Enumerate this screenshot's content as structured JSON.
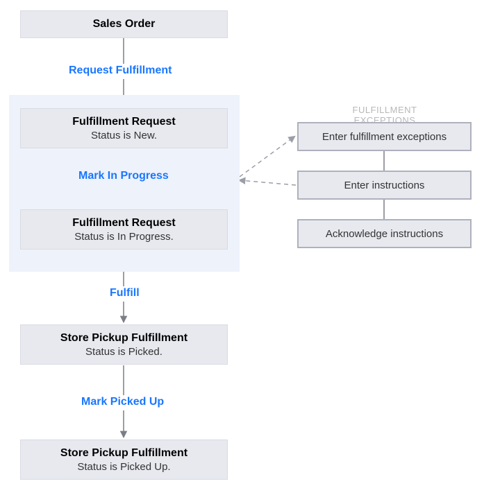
{
  "nodes": {
    "sales_order": {
      "title": "Sales Order"
    },
    "fr_new": {
      "title": "Fulfillment Request",
      "status": "Status is New."
    },
    "fr_inprogress": {
      "title": "Fulfillment Request",
      "status": "Status is In Progress."
    },
    "sp_picked": {
      "title": "Store Pickup Fulfillment",
      "status": "Status is Picked."
    },
    "sp_pickedup": {
      "title": "Store Pickup Fulfillment",
      "status": "Status is Picked Up."
    }
  },
  "actions": {
    "request_fulfillment": "Request Fulfillment",
    "mark_in_progress": "Mark In Progress",
    "fulfill": "Fulfill",
    "mark_picked_up": "Mark Picked Up"
  },
  "exceptions": {
    "title": "FULFILLMENT EXCEPTIONS",
    "items": {
      "enter_exceptions": "Enter fulfillment exceptions",
      "enter_instructions": "Enter instructions",
      "ack_instructions": "Acknowledge instructions"
    }
  },
  "colors": {
    "action_link": "#1976ff",
    "node_bg": "#e7e9ef",
    "group_bg": "#eef2fb",
    "arrow": "#7a7e87",
    "dashed": "#9a9ea7"
  }
}
